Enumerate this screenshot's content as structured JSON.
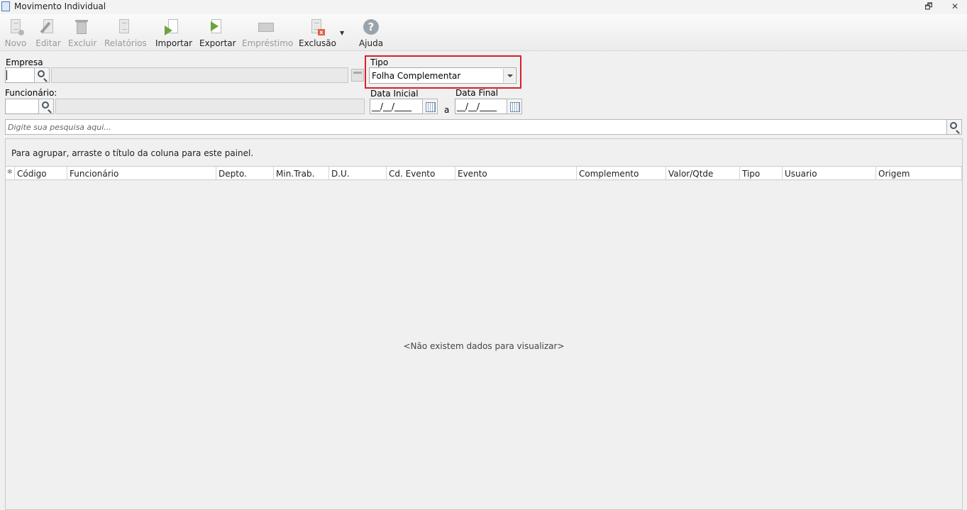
{
  "window": {
    "title": "Movimento Individual",
    "restore_glyph": "🗗",
    "close_glyph": "✕"
  },
  "toolbar": {
    "novo": "Novo",
    "editar": "Editar",
    "excluir": "Excluir",
    "relatorios": "Relatórios",
    "importar": "Importar",
    "exportar": "Exportar",
    "emprestimo": "Empréstimo",
    "exclusao": "Exclusão",
    "ajuda": "Ajuda",
    "exclusao_arrow": "▼"
  },
  "form": {
    "empresa_label": "Empresa",
    "funcionario_label": "Funcionário:",
    "tipo_label": "Tipo",
    "tipo_value": "Folha Complementar",
    "data_inicial_label": "Data Inicial",
    "data_final_label": "Data Final",
    "date_mask": "__/__/____",
    "between": "a"
  },
  "search": {
    "placeholder": "Digite sua pesquisa aqui..."
  },
  "grid": {
    "group_hint": "Para agrupar, arraste o título da coluna para este painel.",
    "indicator": "✻",
    "columns": [
      "Código",
      "Funcionário",
      "Depto.",
      "Min.Trab.",
      "D.U.",
      "Cd. Evento",
      "Evento",
      "Complemento",
      "Valor/Qtde",
      "Tipo",
      "Usuario",
      "Origem"
    ],
    "empty_message": "<Não existem dados para visualizar>"
  },
  "colors": {
    "highlight": "#d7202d",
    "accent_green": "#6ea33d"
  }
}
